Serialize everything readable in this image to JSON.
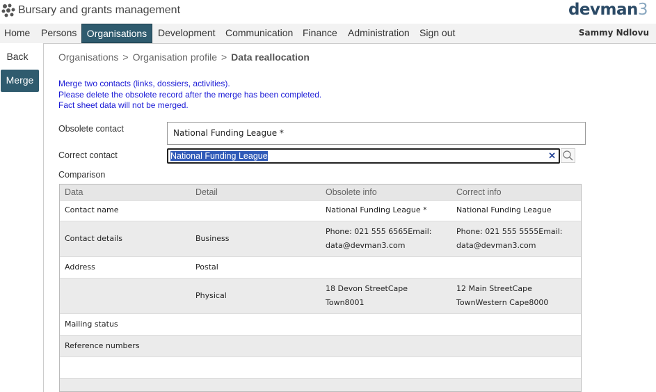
{
  "header": {
    "app_title": "Bursary and grants management",
    "brand_text": "devman",
    "brand_num": "3",
    "user": "Sammy Ndlovu"
  },
  "nav": {
    "items": [
      {
        "label": "Home"
      },
      {
        "label": "Persons"
      },
      {
        "label": "Organisations",
        "active": true
      },
      {
        "label": "Development"
      },
      {
        "label": "Communication"
      },
      {
        "label": "Finance"
      },
      {
        "label": "Administration"
      },
      {
        "label": "Sign out"
      }
    ]
  },
  "sidebar": {
    "back": "Back",
    "merge": "Merge"
  },
  "breadcrumb": {
    "items": [
      "Organisations",
      "Organisation profile",
      "Data reallocation"
    ],
    "separator": ">"
  },
  "info": {
    "line1": "Merge two contacts (links, dossiers, activities).",
    "line2": "Please delete the obsolete record after the merge has been completed.",
    "line3": "Fact sheet data will not be merged."
  },
  "form": {
    "obsolete_label": "Obsolete contact",
    "obsolete_value": "National Funding League *",
    "correct_label": "Correct contact",
    "correct_value": "National Funding League",
    "comparison_label": "Comparison",
    "clear_icon": "close-icon",
    "search_icon": "magnifier-icon"
  },
  "table": {
    "headers": [
      "Data",
      "Detail",
      "Obsolete info",
      "Correct info"
    ],
    "rows": [
      {
        "data": "Contact name",
        "detail": "",
        "obsolete": [
          "National Funding League *"
        ],
        "correct": [
          "National Funding League"
        ]
      },
      {
        "data": "Contact details",
        "detail": "Business",
        "obsolete": [
          "Phone: 021 555 6565Email:",
          "data@devman3.com"
        ],
        "correct": [
          "Phone: 021 555 5555Email:",
          "data@devman3.com"
        ]
      },
      {
        "data": "Address",
        "detail": "Postal",
        "obsolete": [],
        "correct": []
      },
      {
        "data": "",
        "detail": "Physical",
        "obsolete": [
          "18 Devon StreetCape",
          "Town8001"
        ],
        "correct": [
          "12 Main StreetCape",
          "TownWestern Cape8000"
        ]
      },
      {
        "data": "Mailing status",
        "detail": "",
        "obsolete": [],
        "correct": []
      },
      {
        "data": "Reference numbers",
        "detail": "",
        "obsolete": [],
        "correct": []
      },
      {
        "data": "",
        "detail": "",
        "obsolete": [],
        "correct": []
      },
      {
        "data": "",
        "detail": "",
        "obsolete": [],
        "correct": []
      }
    ]
  },
  "colors": {
    "accent": "#2f5b6e",
    "info_text": "#1a1ad6",
    "selection": "#2f5ab8"
  }
}
